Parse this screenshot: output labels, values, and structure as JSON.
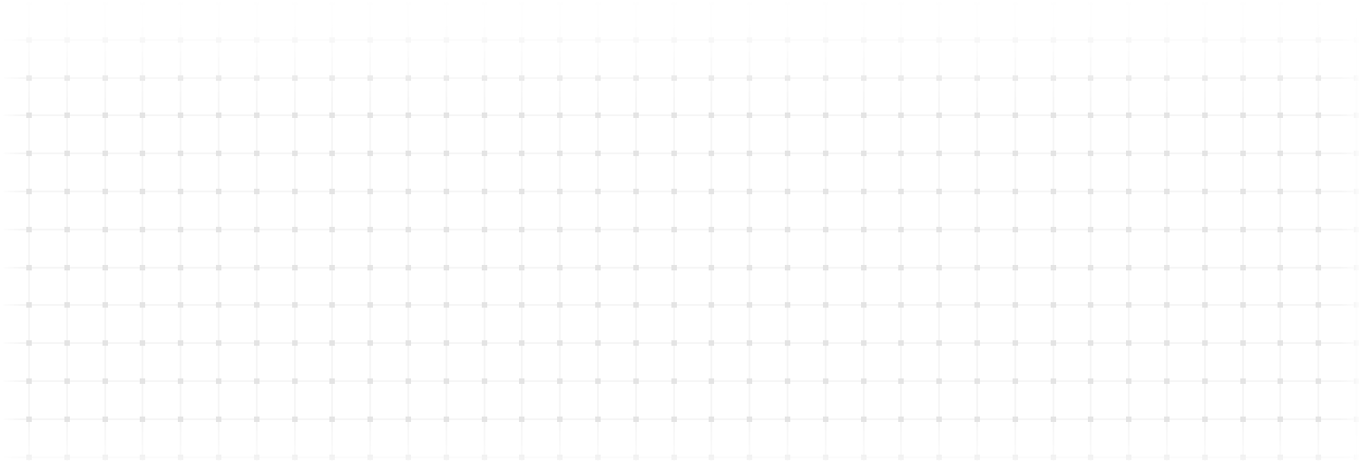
{
  "background": {
    "pattern": "dotted-grid",
    "page_color": "#ffffff",
    "line_color": "#eeeeee",
    "dot_color": "#e4e4e4"
  }
}
